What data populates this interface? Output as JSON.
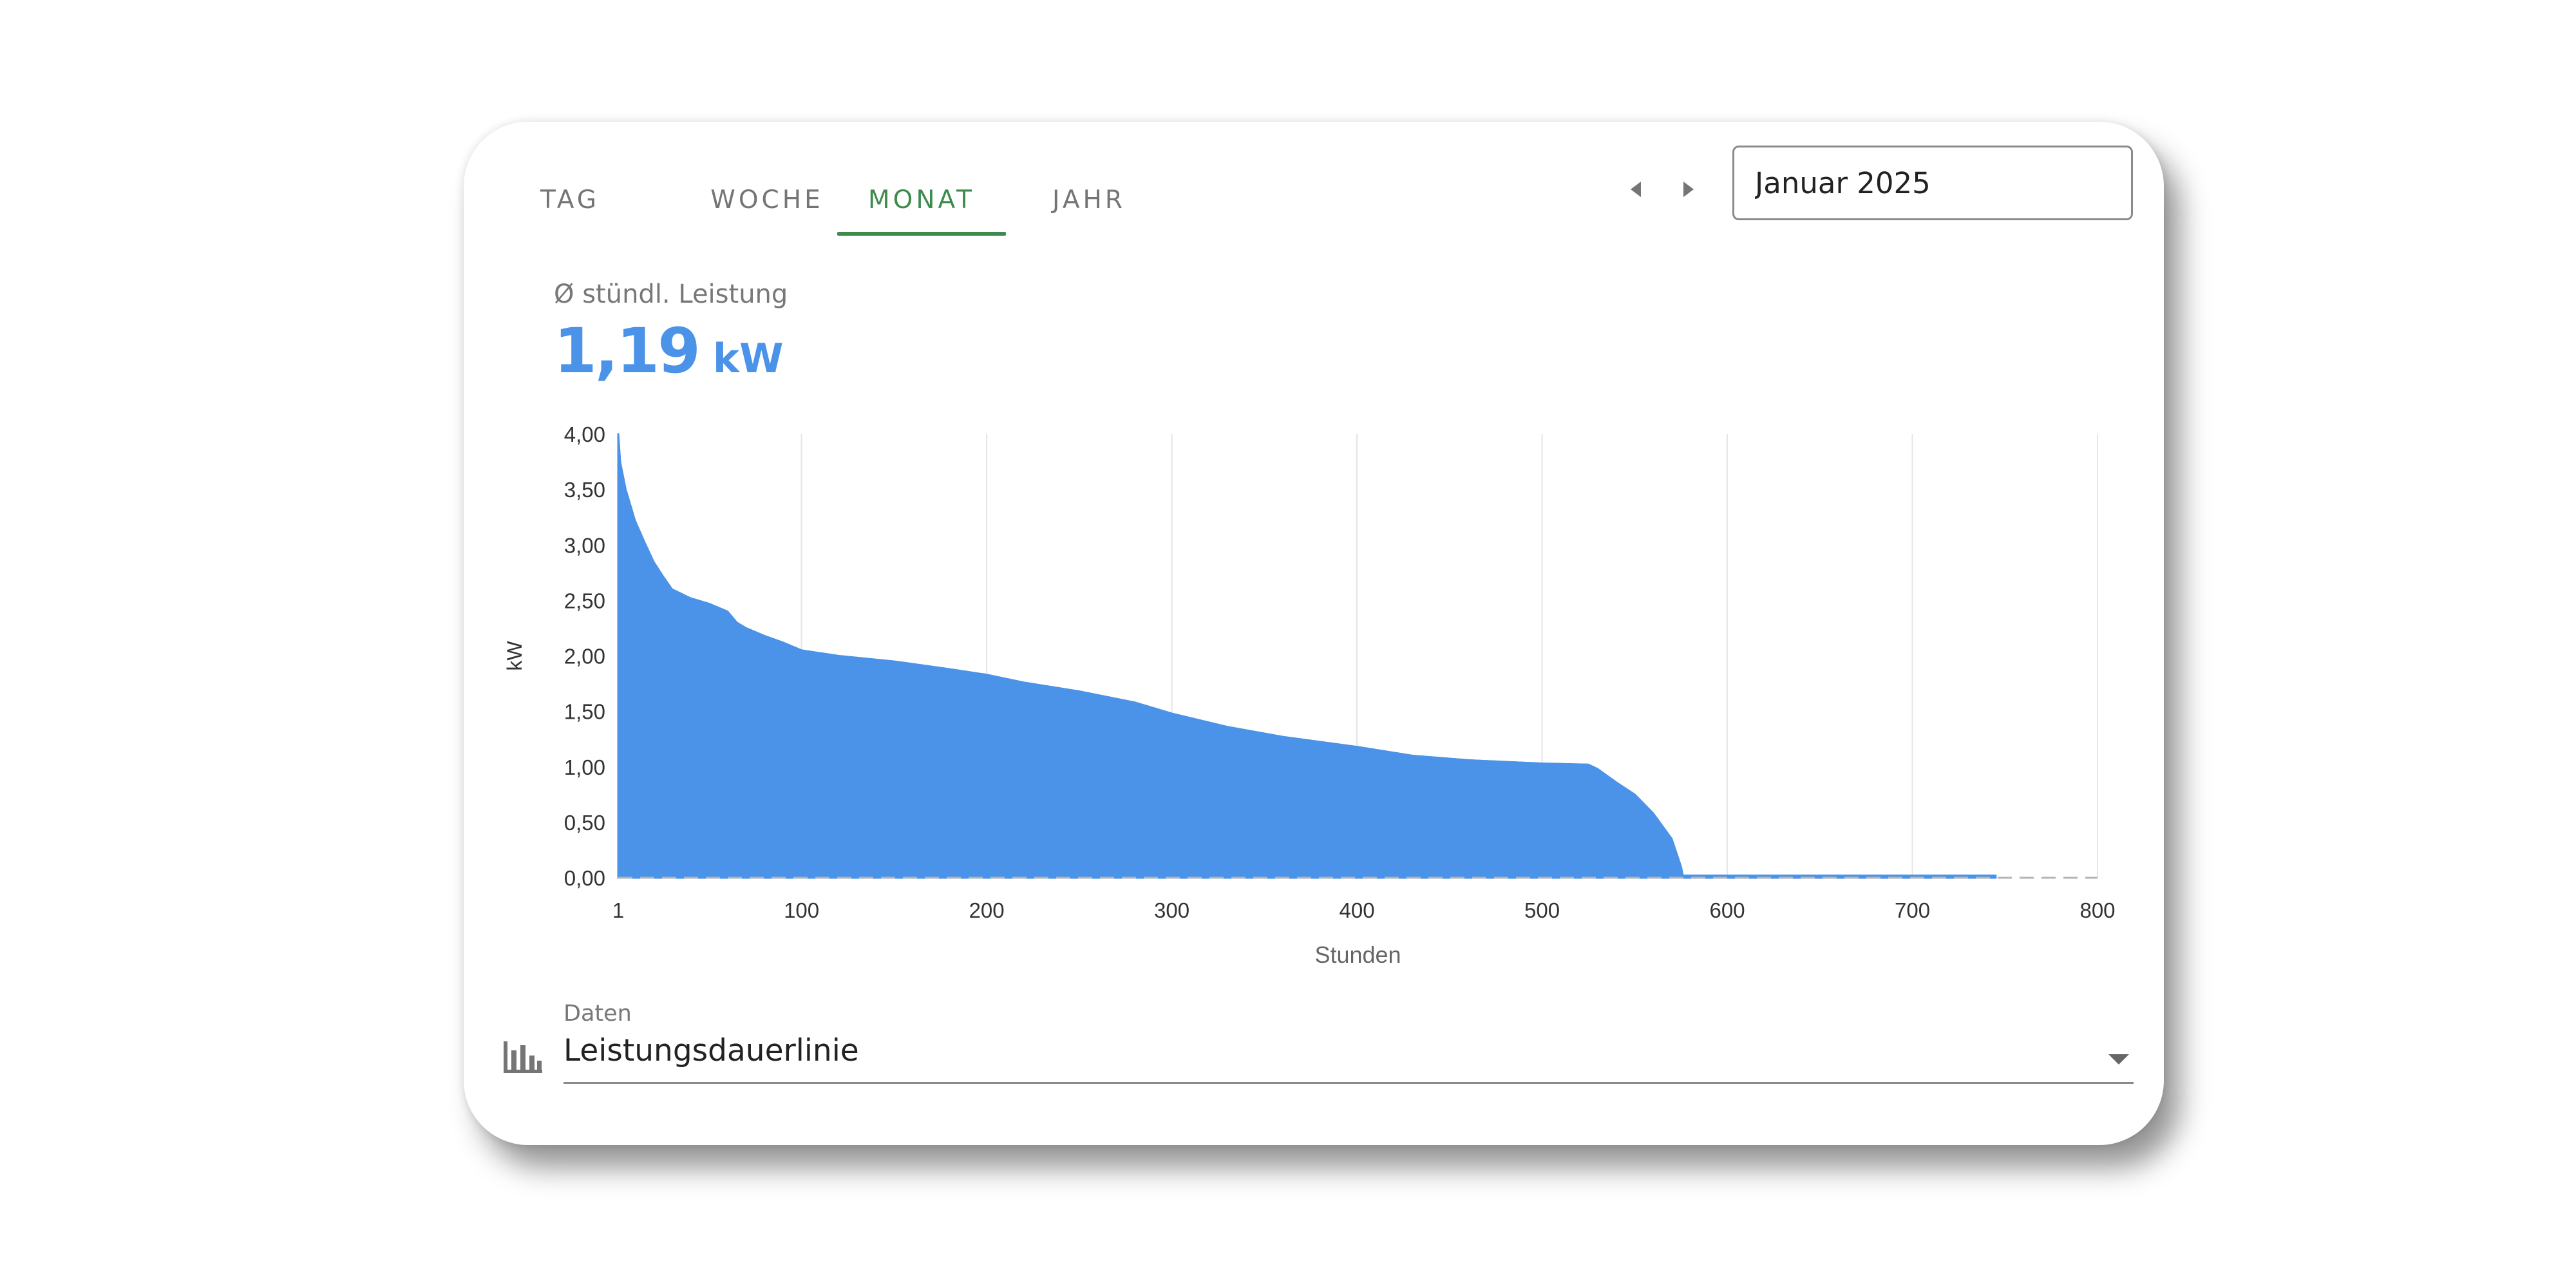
{
  "tabs": [
    {
      "label": "TAG",
      "active": false
    },
    {
      "label": "WOCHE",
      "active": false
    },
    {
      "label": "MONAT",
      "active": true
    },
    {
      "label": "JAHR",
      "active": false
    }
  ],
  "period": {
    "value": "Januar 2025"
  },
  "stat": {
    "label": "Ø stündl. Leistung",
    "value": "1,19",
    "unit": "kW"
  },
  "colors": {
    "accent": "#3d8b4d",
    "series": "#4b93e8",
    "muted": "#757575"
  },
  "icons": {
    "prev": "caret-left-icon",
    "next": "caret-right-icon",
    "data_select": "bar-chart-icon",
    "dropdown": "caret-down-icon"
  },
  "data_select": {
    "label": "Daten",
    "value": "Leistungsdauerlinie"
  },
  "chart_data": {
    "type": "area",
    "xlabel": "Stunden",
    "ylabel": "kW",
    "xlim": [
      1,
      800
    ],
    "ylim": [
      0,
      4
    ],
    "x_ticks": [
      "1",
      "100",
      "200",
      "300",
      "400",
      "500",
      "600",
      "700",
      "800"
    ],
    "y_ticks": [
      "0,00",
      "0,50",
      "1,00",
      "1,50",
      "2,00",
      "2,50",
      "3,00",
      "3,50",
      "4,00"
    ],
    "grid": "vertical",
    "series": [
      {
        "x": [
          1,
          2,
          5,
          10,
          15,
          20,
          25,
          30,
          40,
          50,
          60,
          65,
          70,
          80,
          90,
          100,
          120,
          150,
          180,
          200,
          220,
          250,
          280,
          300,
          330,
          360,
          400,
          430,
          460,
          500,
          525,
          530,
          540,
          550,
          560,
          570,
          575,
          576,
          600,
          700,
          745
        ],
        "y": [
          4.0,
          3.75,
          3.5,
          3.22,
          3.03,
          2.85,
          2.72,
          2.6,
          2.52,
          2.47,
          2.4,
          2.3,
          2.25,
          2.18,
          2.12,
          2.05,
          2.0,
          1.95,
          1.88,
          1.83,
          1.76,
          1.68,
          1.58,
          1.48,
          1.36,
          1.27,
          1.18,
          1.1,
          1.06,
          1.03,
          1.02,
          0.98,
          0.86,
          0.75,
          0.58,
          0.35,
          0.1,
          0.02,
          0.02,
          0.02,
          0.02
        ]
      }
    ]
  }
}
